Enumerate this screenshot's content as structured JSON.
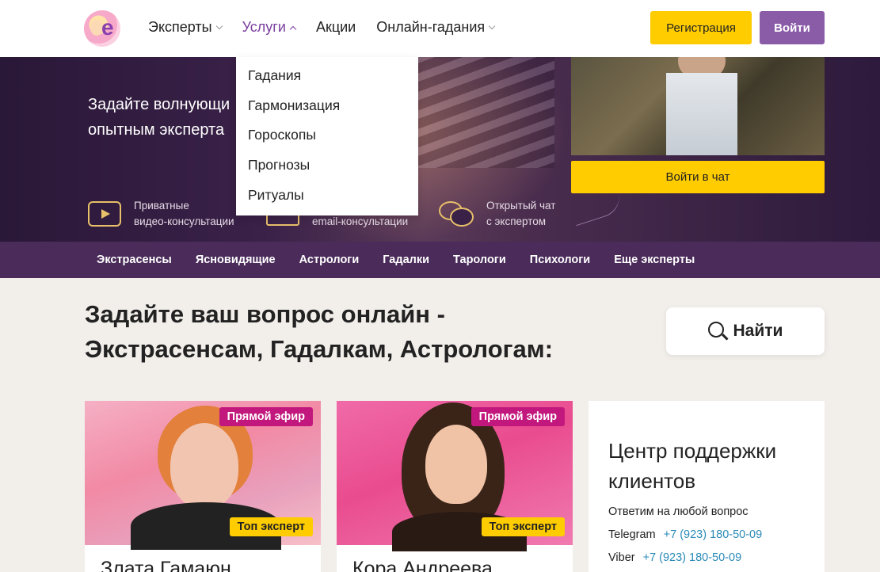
{
  "header": {
    "logo_letter": "e",
    "nav": [
      {
        "label": "Эксперты",
        "dropdown": true,
        "active": false
      },
      {
        "label": "Услуги",
        "dropdown": true,
        "active": true
      },
      {
        "label": "Акции",
        "dropdown": false,
        "active": false
      },
      {
        "label": "Онлайн-гадания",
        "dropdown": true,
        "active": false
      }
    ],
    "register_label": "Регистрация",
    "login_label": "Войти"
  },
  "dropdown": {
    "items": [
      "Гадания",
      "Гармонизация",
      "Гороскопы",
      "Прогнозы",
      "Ритуалы"
    ]
  },
  "hero": {
    "text_line1": "Задайте волнующи",
    "text_line2": "опытным эксперта",
    "chat_button": "Войти в чат",
    "features": [
      {
        "icon": "video-play-icon",
        "line1": "Приватные",
        "line2": "видео-консультации"
      },
      {
        "icon": "mail-icon",
        "line1": "",
        "line2": "email-консультации"
      },
      {
        "icon": "chat-bubbles-icon",
        "line1": "Открытый чат",
        "line2": "с экспертом"
      }
    ]
  },
  "categories": [
    "Экстрасенсы",
    "Ясновидящие",
    "Астрологи",
    "Гадалки",
    "Тарологи",
    "Психологи",
    "Еще эксперты"
  ],
  "main": {
    "title_line1": "Задайте ваш вопрос онлайн -",
    "title_line2": "Экстрасенсам, Гадалкам, Астрологам:",
    "search_label": "Найти"
  },
  "experts": [
    {
      "name": "Злата Гамаюн",
      "live_badge": "Прямой эфир",
      "top_badge": "Топ эксперт"
    },
    {
      "name": "Кора Андреева",
      "live_badge": "Прямой эфир",
      "top_badge": "Топ эксперт"
    }
  ],
  "support": {
    "title_line1": "Центр поддержки",
    "title_line2": "клиентов",
    "subtitle": "Ответим на любой вопрос",
    "contacts": [
      {
        "label": "Telegram",
        "phone": "+7 (923) 180-50-09"
      },
      {
        "label": "Viber",
        "phone": "+7 (923) 180-50-09"
      }
    ]
  },
  "colors": {
    "accent_yellow": "#ffcc00",
    "accent_purple": "#8a5ca8",
    "nav_active": "#7a3ea0",
    "category_bar": "#4a2b5a",
    "live_badge": "#c2187d",
    "link": "#2a8ab8"
  }
}
